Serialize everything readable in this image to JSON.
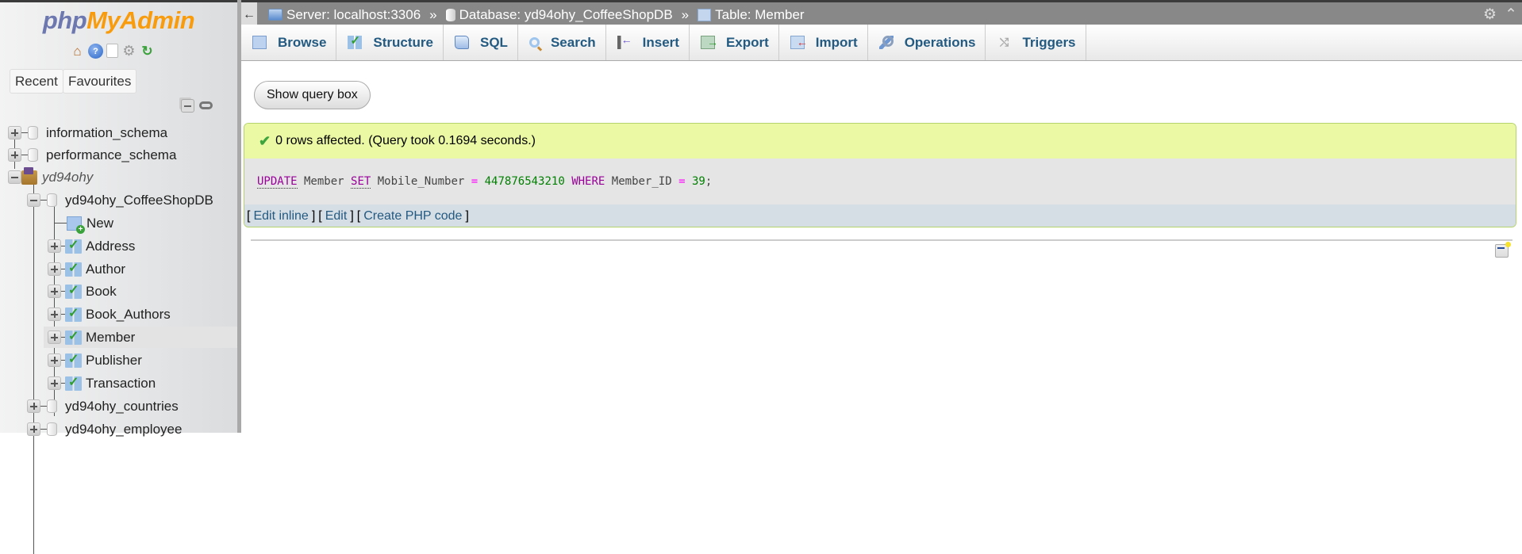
{
  "app": {
    "logo_part1": "php",
    "logo_part2": "MyAdmin",
    "brand_colors": {
      "php": "#6c78af",
      "myadmin": "#f89c0e",
      "link": "#235a81",
      "success_bg": "#ebf8a4"
    }
  },
  "sidebar": {
    "nav_icons": [
      "home-icon",
      "help-icon",
      "documentation-icon",
      "settings-icon",
      "reload-icon"
    ],
    "recent_label": "Recent",
    "favourites_label": "Favourites",
    "tree": [
      {
        "label": "information_schema",
        "type": "database",
        "expanded": false
      },
      {
        "label": "performance_schema",
        "type": "database",
        "expanded": false
      },
      {
        "label": "yd94ohy",
        "type": "group",
        "expanded": true
      },
      {
        "label": "yd94ohy_CoffeeShopDB",
        "type": "database",
        "expanded": true
      },
      {
        "label": "New",
        "type": "new-table"
      },
      {
        "label": "Address",
        "type": "table"
      },
      {
        "label": "Author",
        "type": "table"
      },
      {
        "label": "Book",
        "type": "table"
      },
      {
        "label": "Book_Authors",
        "type": "table"
      },
      {
        "label": "Member",
        "type": "table",
        "selected": true
      },
      {
        "label": "Publisher",
        "type": "table"
      },
      {
        "label": "Transaction",
        "type": "table"
      },
      {
        "label": "yd94ohy_countries",
        "type": "database",
        "expanded": false
      },
      {
        "label": "yd94ohy_employee",
        "type": "database",
        "expanded": false
      }
    ]
  },
  "breadcrumb": {
    "back": "←",
    "server": "Server: localhost:3306",
    "database": "Database: yd94ohy_CoffeeShopDB",
    "table": "Table: Member",
    "separator": "»"
  },
  "tabs": [
    {
      "label": "Browse",
      "icon": "browse-icon"
    },
    {
      "label": "Structure",
      "icon": "structure-icon"
    },
    {
      "label": "SQL",
      "icon": "sql-icon"
    },
    {
      "label": "Search",
      "icon": "search-icon"
    },
    {
      "label": "Insert",
      "icon": "insert-icon"
    },
    {
      "label": "Export",
      "icon": "export-icon"
    },
    {
      "label": "Import",
      "icon": "import-icon"
    },
    {
      "label": "Operations",
      "icon": "operations-icon"
    },
    {
      "label": "Triggers",
      "icon": "triggers-icon"
    }
  ],
  "main": {
    "show_query_box": "Show query box",
    "result_message": "0 rows affected. (Query took 0.1694 seconds.)",
    "sql": {
      "kw_update": "UPDATE",
      "table": " Member ",
      "kw_set": "SET",
      "column": " Mobile_Number ",
      "op1": "=",
      "value": " 447876543210 ",
      "kw_where": "WHERE",
      "where_col": " Member_ID ",
      "op2": "=",
      "where_val": " 39",
      "terminator": ";"
    },
    "links": {
      "edit_inline": "Edit inline",
      "edit": "Edit",
      "create_php": "Create PHP code",
      "open": "[",
      "close": "]"
    }
  }
}
